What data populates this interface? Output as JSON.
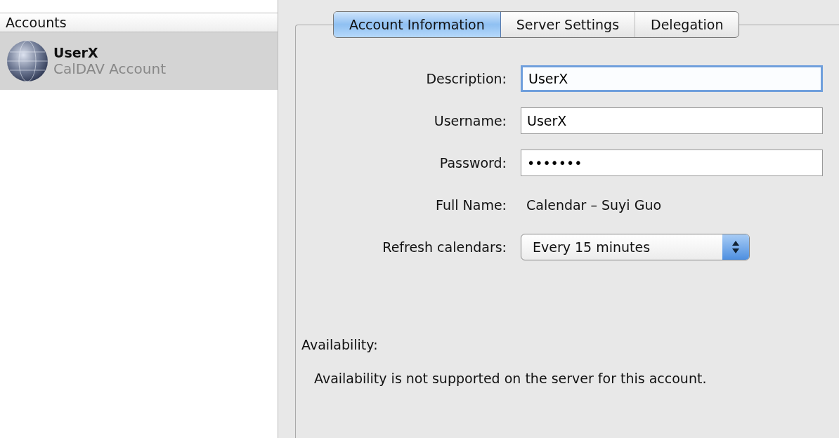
{
  "sidebar": {
    "header": "Accounts",
    "items": [
      {
        "name": "UserX",
        "type": "CalDAV Account",
        "selected": true
      }
    ]
  },
  "tabs": [
    {
      "label": "Account Information",
      "selected": true
    },
    {
      "label": "Server Settings",
      "selected": false
    },
    {
      "label": "Delegation",
      "selected": false
    }
  ],
  "fields": [
    {
      "kind": "text",
      "label": "Description:",
      "value": "UserX",
      "focused": true
    },
    {
      "kind": "text",
      "label": "Username:",
      "value": "UserX",
      "focused": false
    },
    {
      "kind": "password",
      "label": "Password:",
      "value": "•••••••",
      "focused": false
    },
    {
      "kind": "static",
      "label": "Full Name:",
      "value": "Calendar – Suyi Guo"
    },
    {
      "kind": "popup",
      "label": "Refresh calendars:",
      "value": "Every 15 minutes"
    }
  ],
  "availability": {
    "label": "Availability:",
    "message": "Availability is not supported on the server for this account."
  }
}
